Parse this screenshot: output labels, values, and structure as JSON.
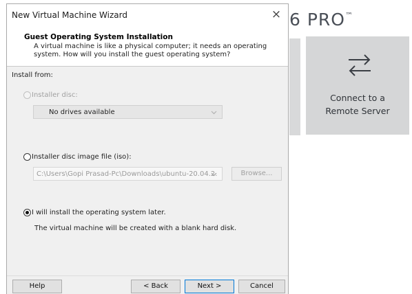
{
  "background_app": {
    "brand_text": "6 PRO",
    "brand_tm": "™",
    "connect_tile": {
      "icon": "swap-arrows-icon",
      "line1": "Connect to a",
      "line2": "Remote Server"
    }
  },
  "dialog": {
    "title": "New Virtual Machine Wizard",
    "close_glyph": "×",
    "header": {
      "title": "Guest Operating System Installation",
      "description": "A virtual machine is like a physical computer; it needs an operating system. How will you install the guest operating system?"
    },
    "install_from_label": "Install from:",
    "options": {
      "installer_disc": {
        "label": "Installer disc:",
        "selected": false,
        "enabled": false,
        "drive_value": "No drives available"
      },
      "iso": {
        "label": "Installer disc image file (iso):",
        "selected": false,
        "path_value": "C:\\Users\\Gopi Prasad-Pc\\Downloads\\ubuntu-20.04.2.",
        "browse_label": "Browse..."
      },
      "later": {
        "label": "I will install the operating system later.",
        "selected": true,
        "note": "The virtual machine will be created with a blank hard disk."
      }
    },
    "buttons": {
      "help": "Help",
      "back": "< Back",
      "next": "Next >",
      "cancel": "Cancel"
    }
  },
  "colors": {
    "dialog_bg": "#f0f0f0",
    "tile_bg": "#d5d6d7",
    "default_button_border": "#0078d7"
  }
}
